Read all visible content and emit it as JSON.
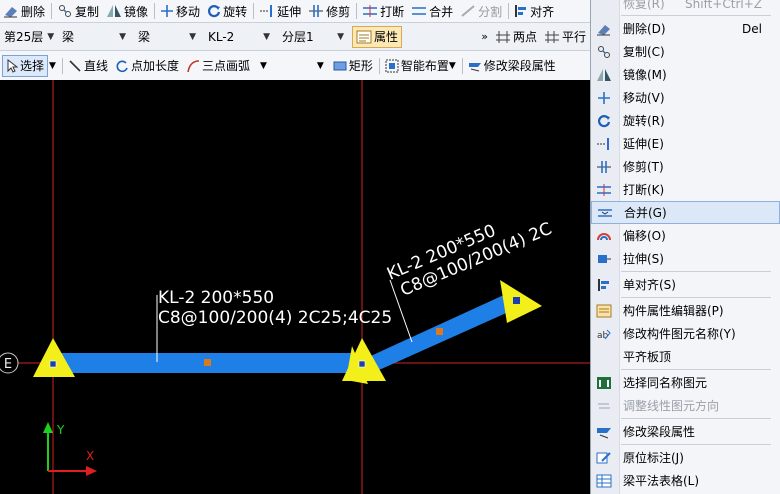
{
  "toolbar1": {
    "delete": "删除",
    "copy": "复制",
    "mirror": "镜像",
    "move": "移动",
    "rotate": "旋转",
    "extend": "延伸",
    "trim": "修剪",
    "break": "打断",
    "merge": "合并",
    "split": "分割",
    "align": "对齐"
  },
  "toolbar2": {
    "floor": "第25层",
    "category": "梁",
    "type": "梁",
    "name": "KL-2",
    "layer": "分层1",
    "properties": "属性",
    "two_point": "两点",
    "parallel": "平行"
  },
  "toolbar3": {
    "select": "选择",
    "line": "直线",
    "point_length": "点加长度",
    "arc": "三点画弧",
    "rect": "矩形",
    "smart_place": "智能布置",
    "modify_span": "修改梁段属性"
  },
  "canvas": {
    "beam_label_1_line1": "KL-2 200*550",
    "beam_label_1_line2": "C8@100/200(4) 2C25;4C25",
    "beam_label_2_line1": "KL-2 200*550",
    "beam_label_2_line2": "C8@100/200(4) 2C",
    "axis_bubble": "E",
    "axis_y": "Y",
    "axis_x": "X",
    "colors": {
      "beam": "#1e7fe6",
      "grid": "#d21f1f",
      "support": "#f2ef1a",
      "label": "#ffffff"
    }
  },
  "context_menu": {
    "top_partial": {
      "label": "恢复(R)",
      "shortcut": "Shift+Ctrl+Z"
    },
    "items": [
      {
        "label": "删除(D)",
        "shortcut": "Del",
        "icon": "eraser-icon"
      },
      {
        "label": "复制(C)",
        "icon": "copy-icon"
      },
      {
        "label": "镜像(M)",
        "icon": "mirror-icon"
      },
      {
        "label": "移动(V)",
        "icon": "move-icon"
      },
      {
        "label": "旋转(R)",
        "icon": "rotate-icon"
      },
      {
        "label": "延伸(E)",
        "icon": "extend-icon"
      },
      {
        "label": "修剪(T)",
        "icon": "trim-icon"
      },
      {
        "label": "打断(K)",
        "icon": "break-icon"
      },
      {
        "label": "合并(G)",
        "icon": "merge-icon"
      },
      {
        "label": "偏移(O)",
        "icon": "offset-icon"
      },
      {
        "label": "拉伸(S)",
        "icon": "stretch-icon"
      },
      {
        "label": "单对齐(S)",
        "icon": "align-icon"
      },
      {
        "label": "构件属性编辑器(P)",
        "icon": "property-editor-icon"
      },
      {
        "label": "修改构件图元名称(Y)",
        "icon": "rename-icon"
      },
      {
        "label": "平齐板顶",
        "icon": "none"
      },
      {
        "label": "选择同名称图元",
        "icon": "select-same-icon"
      },
      {
        "label": "调整线性图元方向",
        "icon": "direction-icon"
      },
      {
        "label": "修改梁段属性",
        "icon": "beam-span-icon"
      },
      {
        "label": "原位标注(J)",
        "icon": "annotate-icon"
      },
      {
        "label": "梁平法表格(L)",
        "icon": "table-icon"
      }
    ]
  }
}
